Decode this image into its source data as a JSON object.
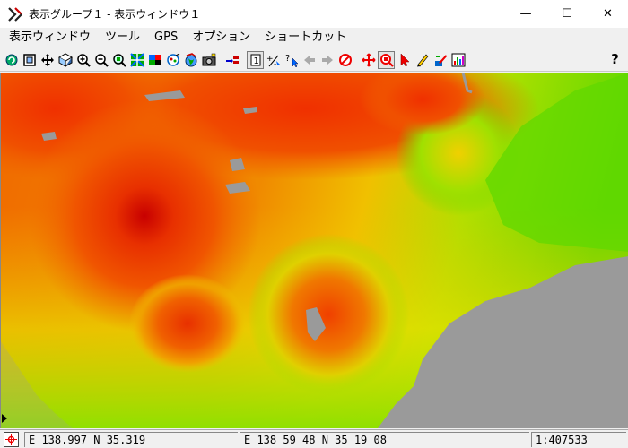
{
  "window": {
    "title": "表示グループ１ - 表示ウィンドウ１",
    "minimize_glyph": "—",
    "maximize_glyph": "☐",
    "close_glyph": "✕"
  },
  "menu": {
    "items": [
      "表示ウィンドウ",
      "ツール",
      "GPS",
      "オプション",
      "ショートカット"
    ]
  },
  "toolbar": {
    "icons": [
      "redraw-icon",
      "full-extent-icon",
      "pan-icon",
      "zoom-box-icon",
      "zoom-in-icon",
      "zoom-out-icon",
      "zoom-layer-icon",
      "layer-controls-icon",
      "group-controls-icon",
      "raster-icon",
      "globe-icon",
      "camera-icon",
      "add-layer-icon",
      "select-one-icon",
      "plus-minus-icon",
      "query-icon",
      "back-arrow-icon",
      "forward-arrow-icon",
      "stop-icon",
      "crosshair-icon",
      "zoom-target-icon",
      "pointer-icon",
      "pencil-icon",
      "edit-icon",
      "histogram-icon"
    ],
    "help_glyph": "?"
  },
  "status": {
    "coord_decimal": "E 138.997  N 35.319",
    "coord_dms": "E 138 59 48  N 35 19 08",
    "scale": "1:407533"
  },
  "colors": {
    "map_peak": "#c80000",
    "map_high": "#f04000",
    "map_mid": "#f0b000",
    "map_low": "#90e000",
    "map_lowest": "#40d000",
    "water": "#9a9a9a"
  }
}
